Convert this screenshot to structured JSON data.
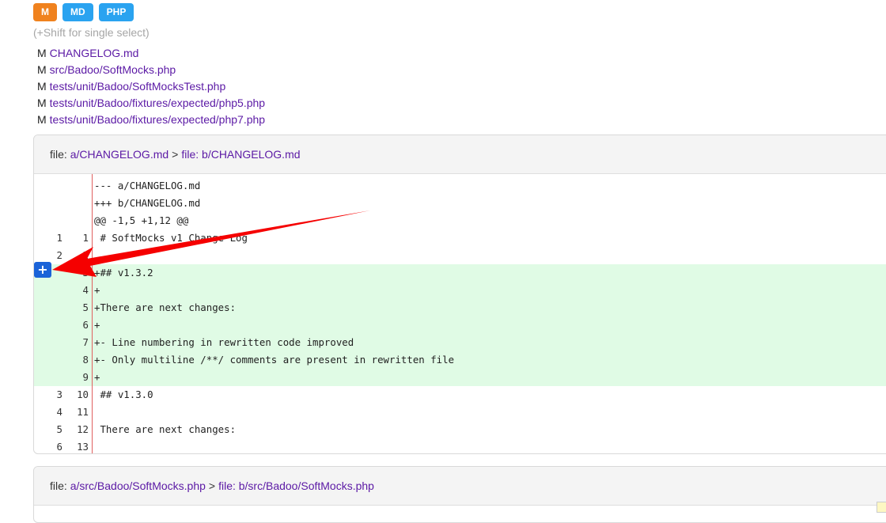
{
  "filters": {
    "buttons": [
      {
        "label": "M",
        "color": "#f0821e"
      },
      {
        "label": "MD",
        "color": "#2aa3f0"
      },
      {
        "label": "PHP",
        "color": "#2aa3f0"
      }
    ],
    "hint": "(+Shift for single select)"
  },
  "files": [
    {
      "status": "M",
      "path": "CHANGELOG.md"
    },
    {
      "status": "M",
      "path": "src/Badoo/SoftMocks.php"
    },
    {
      "status": "M",
      "path": "tests/unit/Badoo/SoftMocksTest.php"
    },
    {
      "status": "M",
      "path": "tests/unit/Badoo/fixtures/expected/php5.php"
    },
    {
      "status": "M",
      "path": "tests/unit/Badoo/fixtures/expected/php7.php"
    }
  ],
  "diff1": {
    "header": {
      "prefix": "file: ",
      "from": "a/CHANGELOG.md",
      "sep": ">",
      "to": "file: b/CHANGELOG.md"
    },
    "lines": [
      {
        "old": "",
        "new": "",
        "text": "--- a/CHANGELOG.md",
        "type": "meta"
      },
      {
        "old": "",
        "new": "",
        "text": "+++ b/CHANGELOG.md",
        "type": "meta"
      },
      {
        "old": "",
        "new": "",
        "text": "@@ -1,5 +1,12 @@",
        "type": "meta"
      },
      {
        "old": "1",
        "new": "1",
        "text": " # SoftMocks v1 Change Log",
        "type": "ctx"
      },
      {
        "old": "2",
        "new": "2",
        "text": "",
        "type": "ctx"
      },
      {
        "old": "",
        "new": "3",
        "text": "+## v1.3.2",
        "type": "add"
      },
      {
        "old": "",
        "new": "4",
        "text": "+",
        "type": "add"
      },
      {
        "old": "",
        "new": "5",
        "text": "+There are next changes:",
        "type": "add"
      },
      {
        "old": "",
        "new": "6",
        "text": "+",
        "type": "add"
      },
      {
        "old": "",
        "new": "7",
        "text": "+- Line numbering in rewritten code improved",
        "type": "add"
      },
      {
        "old": "",
        "new": "8",
        "text": "+- Only multiline /**/ comments are present in rewritten file",
        "type": "add"
      },
      {
        "old": "",
        "new": "9",
        "text": "+",
        "type": "add"
      },
      {
        "old": "3",
        "new": "10",
        "text": " ## v1.3.0",
        "type": "ctx"
      },
      {
        "old": "4",
        "new": "11",
        "text": "",
        "type": "ctx"
      },
      {
        "old": "5",
        "new": "12",
        "text": " There are next changes:",
        "type": "ctx"
      },
      {
        "old": "6",
        "new": "13",
        "text": "",
        "type": "ctx"
      }
    ],
    "expand_button": "+"
  },
  "diff2": {
    "header": {
      "prefix": "file: ",
      "from": "a/src/Badoo/SoftMocks.php",
      "sep": ">",
      "to": "file: b/src/Badoo/SoftMocks.php"
    }
  },
  "annotation": {
    "arrow_color": "#f50000"
  }
}
